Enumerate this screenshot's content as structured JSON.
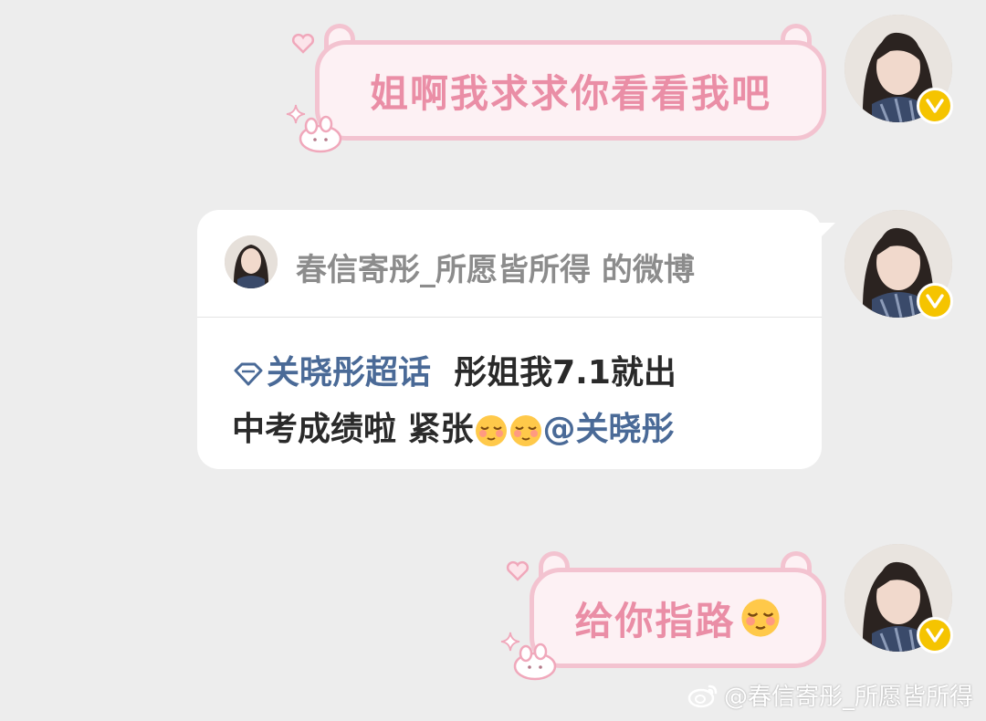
{
  "messages": [
    {
      "text": "姐啊我求求你看看我吧"
    },
    {
      "card": {
        "title": "春信寄彤_所愿皆所得 的微博",
        "topic": "关晓彤超话",
        "line1_rest": "彤姐我7.1就出",
        "line2": "中考成绩啦 紧张",
        "mention": "@关晓彤"
      }
    },
    {
      "text": "给你指路"
    }
  ],
  "watermark": "@春信寄彤_所愿皆所得",
  "colors": {
    "background": "#ededed",
    "pink_text": "#ea8ea6",
    "pink_border": "#f3c3d0",
    "pink_fill": "#fdf1f4",
    "link": "#4a6a97",
    "badge": "#f5c400"
  },
  "icons": [
    "heart-icon",
    "sparkle-icon",
    "bunny-icon",
    "diamond-icon",
    "blush-emoji",
    "verified-badge-icon",
    "weibo-logo-icon"
  ]
}
